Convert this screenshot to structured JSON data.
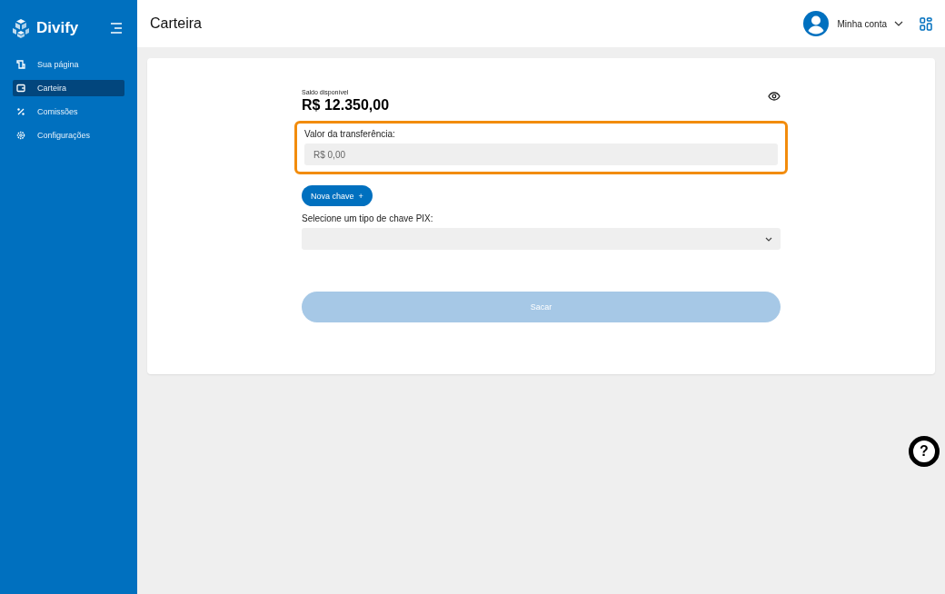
{
  "sidebar": {
    "brand": "Divify",
    "items": [
      {
        "label": "Sua página",
        "selected": false
      },
      {
        "label": "Carteira",
        "selected": true
      },
      {
        "label": "Comissões",
        "selected": false
      },
      {
        "label": "Configurações",
        "selected": false
      }
    ]
  },
  "header": {
    "title": "Carteira",
    "account": "Minha conta"
  },
  "wallet": {
    "balance_label": "Saldo disponível",
    "balance": "R$ 12.350,00",
    "transfer": {
      "label": "Valor da transferência:",
      "placeholder": "R$ 0,00",
      "highlighted": true
    },
    "new_key_button": {
      "label": "Nova chave",
      "icon": "+"
    },
    "pix": {
      "label": "Selecione um tipo de chave PIX:"
    },
    "withdraw_button": {
      "label": "Sacar",
      "disabled": true
    }
  },
  "help": {
    "label": "?"
  }
}
